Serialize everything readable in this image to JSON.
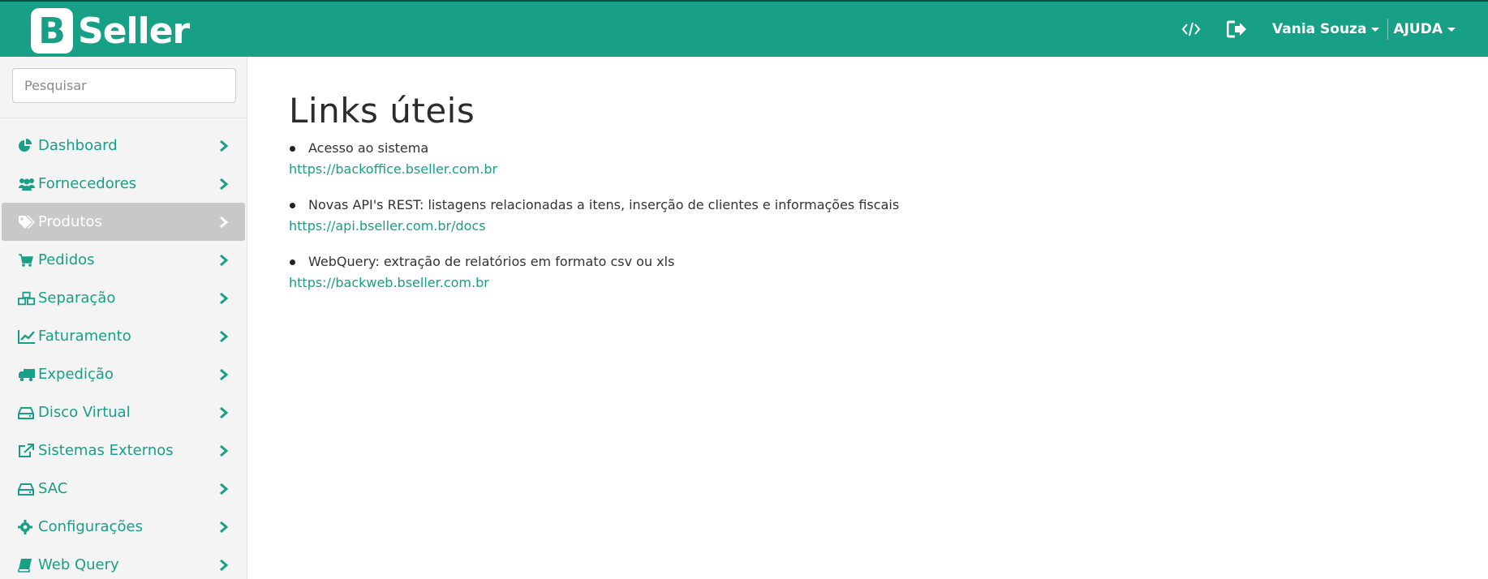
{
  "brand": {
    "logo_letter": "B",
    "name": "Seller",
    "color": "#17a086"
  },
  "header": {
    "icons": [
      "code-icon",
      "logout-icon"
    ],
    "user_name": "Vania Souza",
    "help_label": "AJUDA"
  },
  "sidebar": {
    "search_placeholder": "Pesquisar",
    "items": [
      {
        "label": "Dashboard",
        "icon": "pie-chart-icon",
        "active": false
      },
      {
        "label": "Fornecedores",
        "icon": "users-icon",
        "active": false
      },
      {
        "label": "Produtos",
        "icon": "tags-icon",
        "active": true
      },
      {
        "label": "Pedidos",
        "icon": "shopping-cart-icon",
        "active": false
      },
      {
        "label": "Separação",
        "icon": "cubes-icon",
        "active": false
      },
      {
        "label": "Faturamento",
        "icon": "line-chart-icon",
        "active": false
      },
      {
        "label": "Expedição",
        "icon": "truck-icon",
        "active": false
      },
      {
        "label": "Disco Virtual",
        "icon": "hdd-icon",
        "active": false
      },
      {
        "label": "Sistemas Externos",
        "icon": "external-link-icon",
        "active": false
      },
      {
        "label": "SAC",
        "icon": "hdd-icon",
        "active": false
      },
      {
        "label": "Configurações",
        "icon": "gear-icon",
        "active": false
      },
      {
        "label": "Web Query",
        "icon": "book-icon",
        "active": false
      }
    ]
  },
  "main": {
    "title": "Links úteis",
    "links": [
      {
        "description": "Acesso ao sistema",
        "url": "https://backoffice.bseller.com.br"
      },
      {
        "description": "Novas API's REST: listagens relacionadas a itens, inserção de clientes e informações fiscais",
        "url": "https://api.bseller.com.br/docs"
      },
      {
        "description": "WebQuery: extração de relatórios em formato csv ou xls",
        "url": "https://backweb.bseller.com.br"
      }
    ]
  }
}
